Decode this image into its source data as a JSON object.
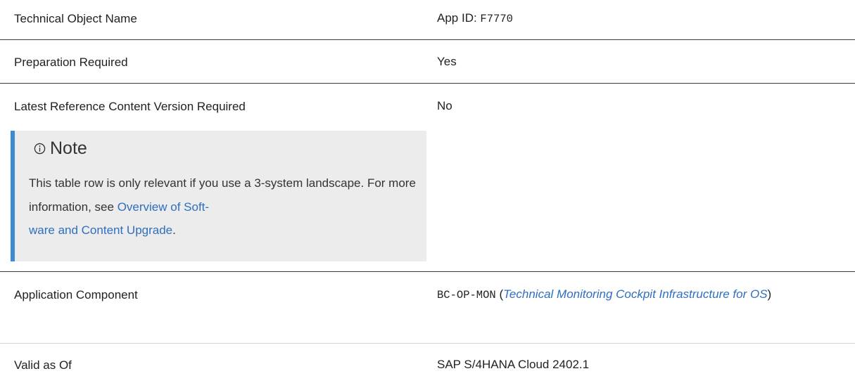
{
  "rows": [
    {
      "label": "Technical Object Name",
      "value_prefix": "App ID: ",
      "value_code": "F7770"
    },
    {
      "label": "Preparation Required",
      "value": "Yes"
    },
    {
      "label": "Latest Reference Content Version Required",
      "value": "No"
    },
    {
      "label": "Application Component",
      "value_code": "BC-OP-MON",
      "value_open": " (",
      "value_link": "Technical Monitoring Cockpit Infrastructure for OS",
      "value_close": ")"
    },
    {
      "label": "Valid as Of",
      "value": "SAP S/4HANA Cloud 2402.1"
    }
  ],
  "note": {
    "icon": "info-circle-icon",
    "title": "Note",
    "text_before": "This table row is only relevant if you use a 3-system landscape. For more information, see ",
    "link": "Overview of Soft-ware and Content Upgrade",
    "link_line1": "Overview of Soft-",
    "link_line2": "ware and Content Upgrade",
    "text_after": ".",
    "accent_color": "#3c8cd2",
    "background_color": "#ececec"
  },
  "link_color": "#2f6fbf"
}
